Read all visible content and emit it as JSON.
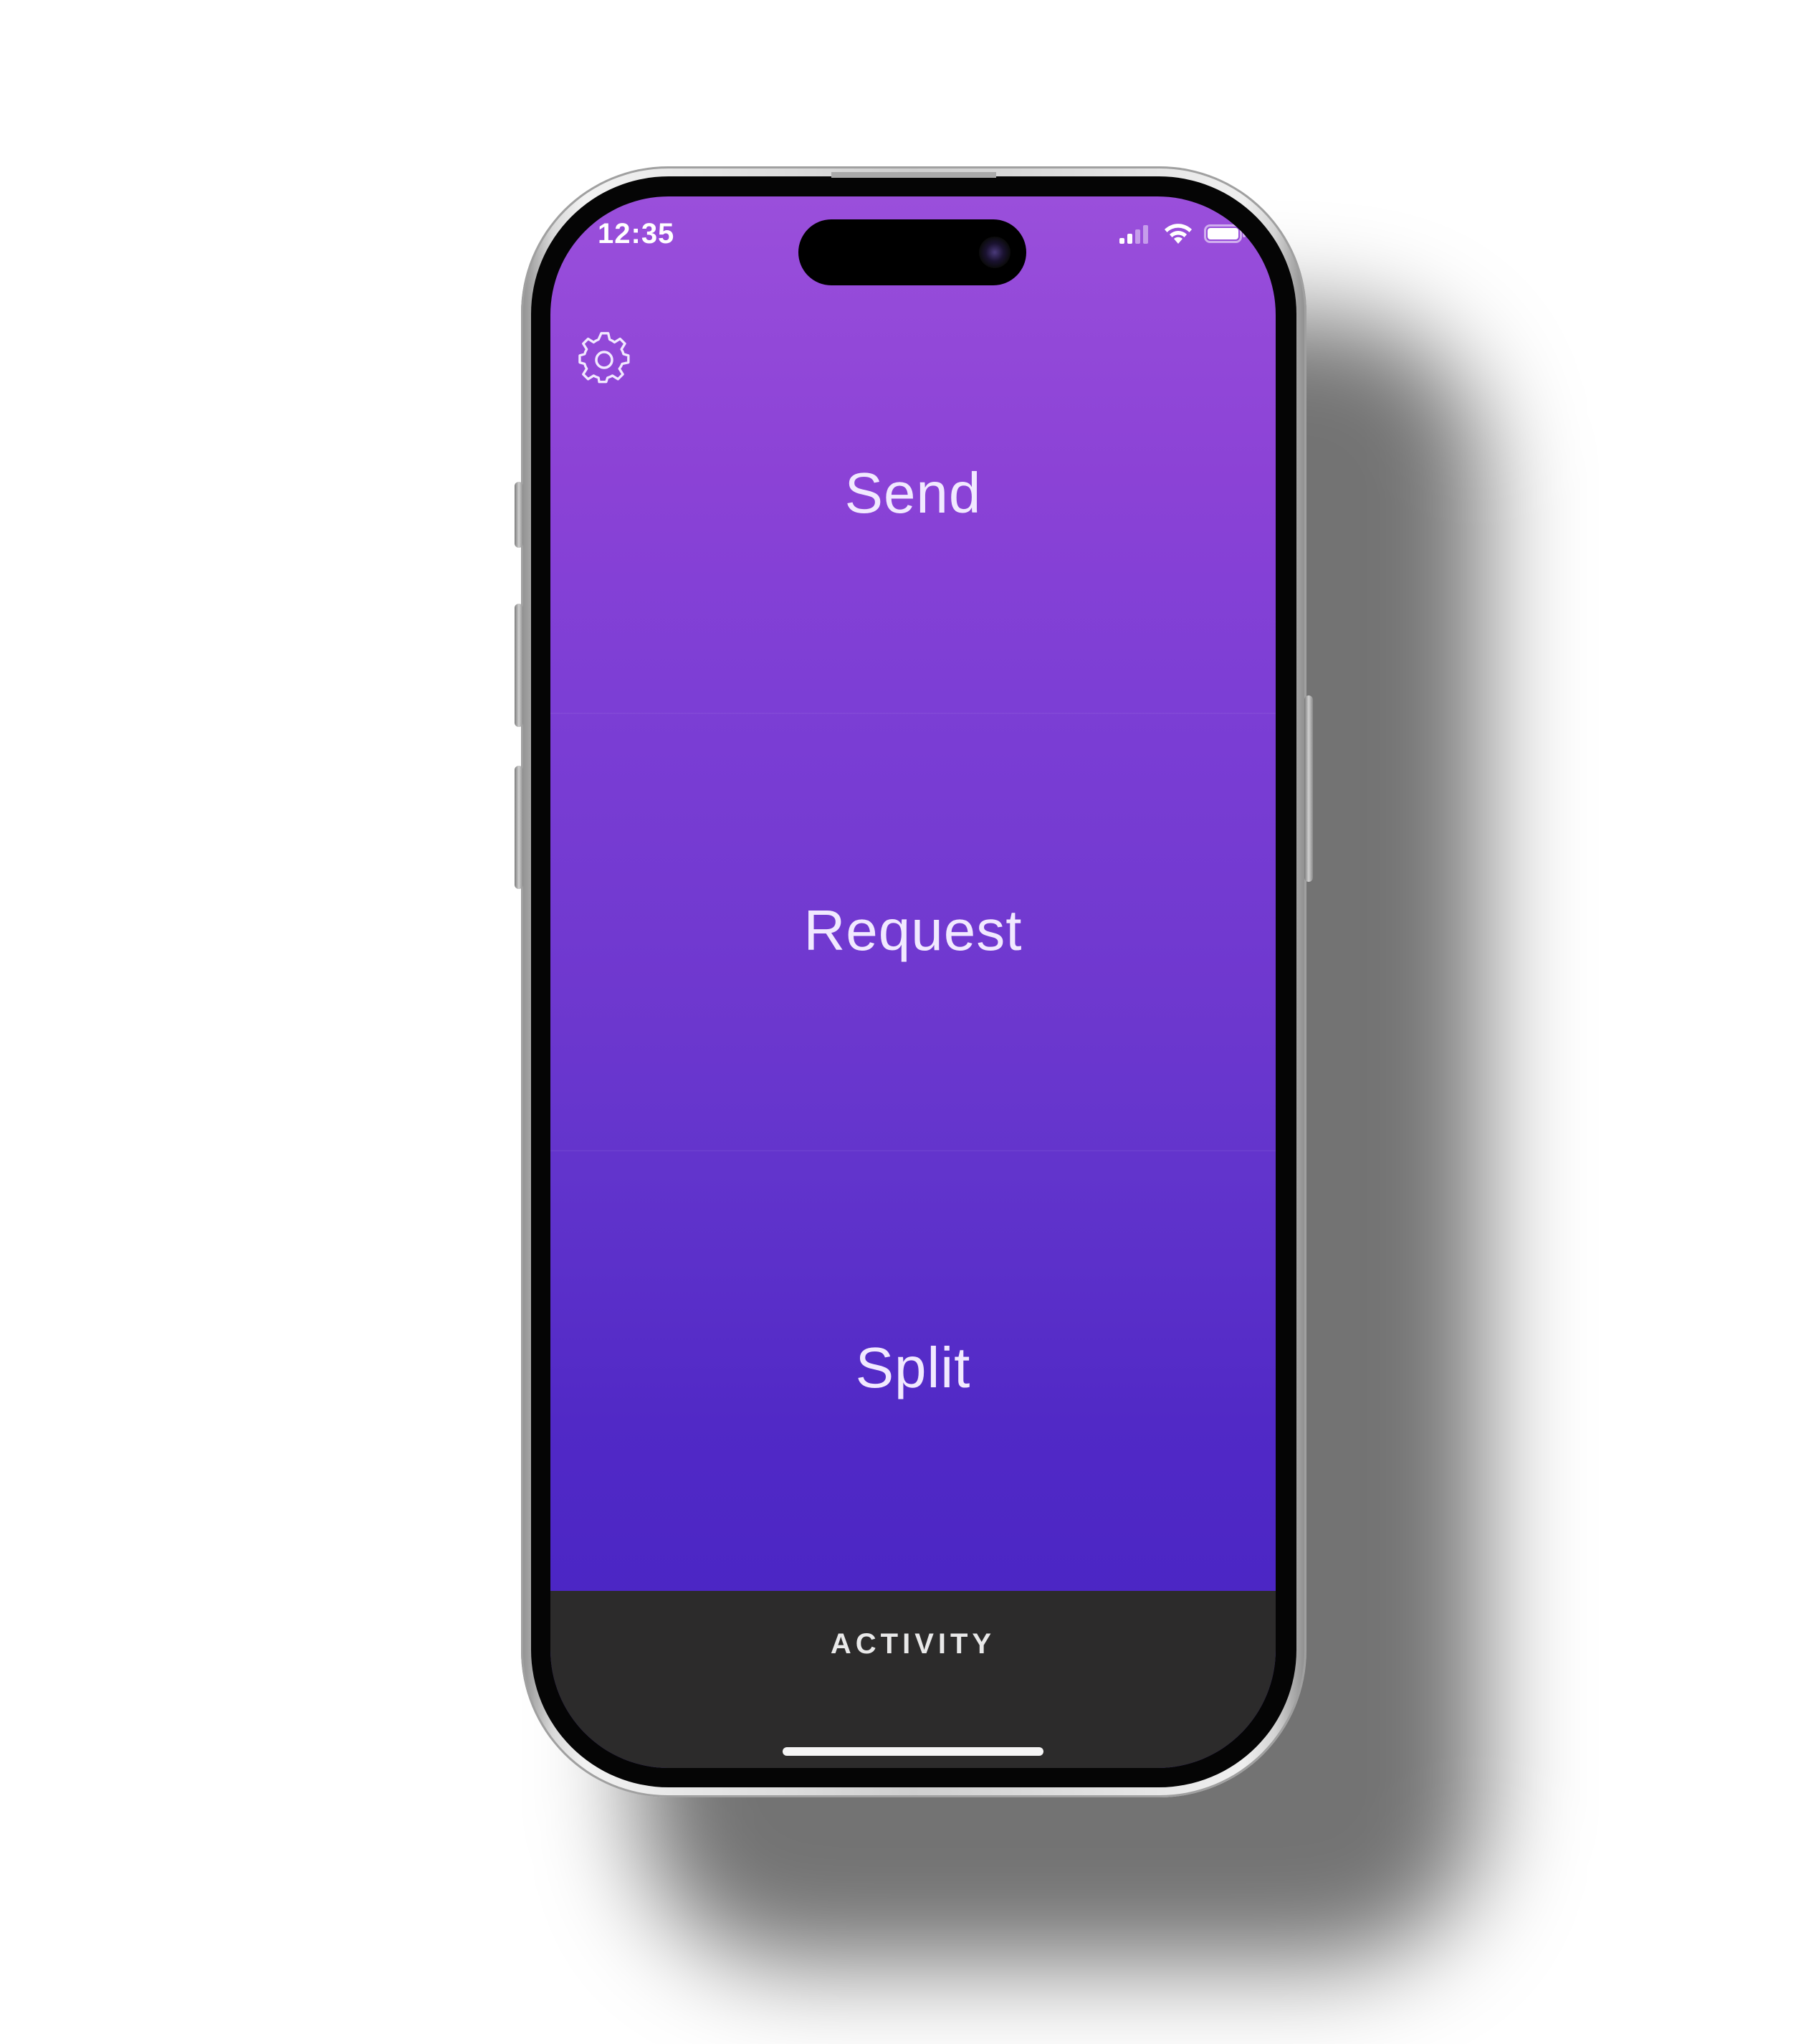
{
  "status_bar": {
    "time": "12:35",
    "icons": [
      "cellular-signal-icon",
      "wifi-icon",
      "battery-icon"
    ]
  },
  "header": {
    "settings_icon": "gear-icon"
  },
  "actions": [
    {
      "label": "Send"
    },
    {
      "label": "Request"
    },
    {
      "label": "Split"
    }
  ],
  "bottom_bar": {
    "label": "ACTIVITY"
  },
  "colors": {
    "gradient_top": "#9a4fdb",
    "gradient_bottom": "#4623c3",
    "bottom_bar": "#2c2b2b",
    "text": "#f1e9ff"
  }
}
